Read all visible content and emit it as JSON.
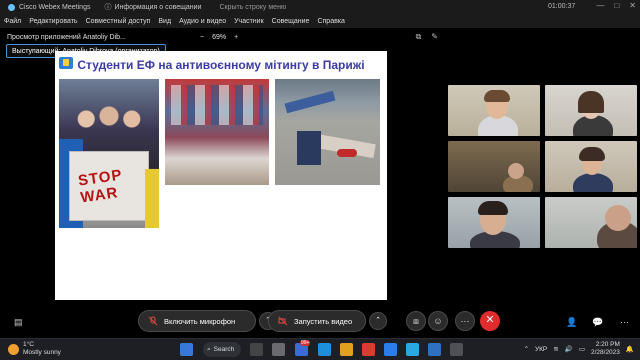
{
  "titlebar": {
    "app_name": "Cisco Webex Meetings",
    "info_label": "Информация о совещании",
    "hide_label": "Скрыть строку меню",
    "timer": "01:00:37"
  },
  "menu": [
    "Файл",
    "Редактировать",
    "Совместный доступ",
    "Вид",
    "Аудио и видео",
    "Участник",
    "Совещание",
    "Справка"
  ],
  "share": {
    "viewing_label": "Просмотр приложений Anatoliy Dib...",
    "zoom_minus": "−",
    "zoom": "69%",
    "zoom_plus": "+",
    "presenter": "Выступающий: Anatoliy Dibrova (организатор)"
  },
  "slide": {
    "title": "Студенти ЕФ на антивоєнному мітингу в Парижі",
    "poster_text": "STOP WAR"
  },
  "controls": {
    "mic_label": "Включить микрофон",
    "video_label": "Запустить видео"
  },
  "taskbar": {
    "temperature": "1°C",
    "weather": "Mostly sunny",
    "search_label": "Search",
    "badge": "99+",
    "language": "УКР",
    "time": "2:20 PM",
    "date": "2/28/2023"
  },
  "colors": {
    "slide_title": "#3b3ba3",
    "end_call": "#e02c2c",
    "presenter_border": "#4a90e2"
  }
}
